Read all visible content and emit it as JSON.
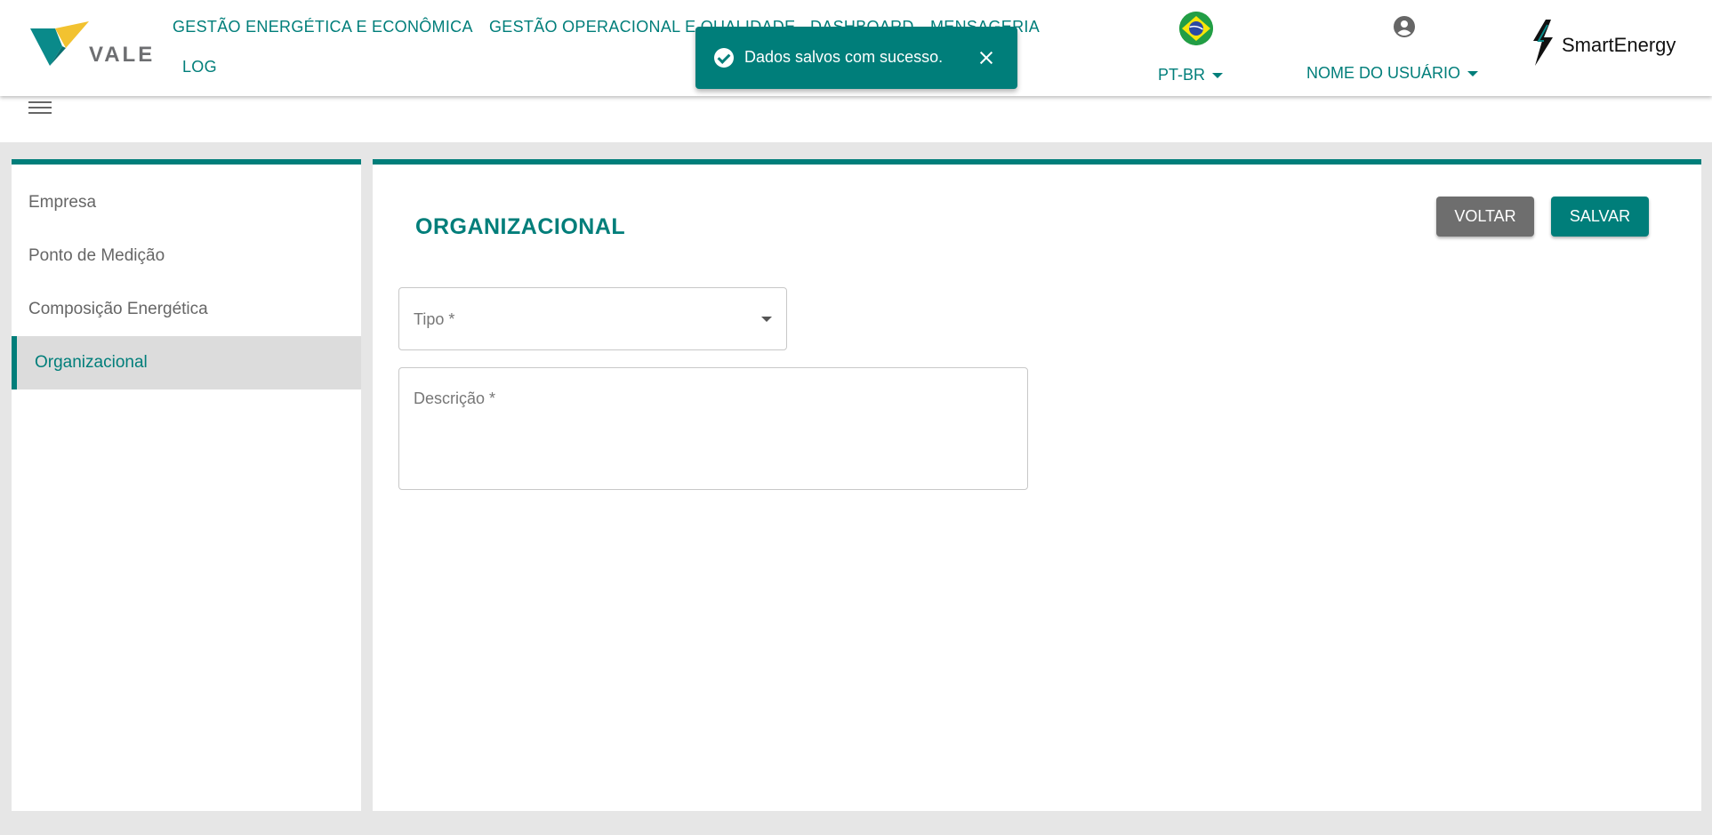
{
  "header": {
    "vale_logo_text": "VALE",
    "nav": [
      "GESTÃO ENERGÉTICA E ECONÔMICA",
      "GESTÃO OPERACIONAL E QUALIDADE",
      "DASHBOARD",
      "MENSAGERIA",
      "LOG"
    ],
    "language": "PT-BR",
    "user_name": "NOME DO USUÁRIO",
    "smart_logo_text": "SmartEnergy"
  },
  "toast": {
    "message": "Dados salvos com sucesso."
  },
  "sidebar": {
    "items": [
      {
        "label": "Empresa",
        "active": false
      },
      {
        "label": "Ponto de Medição",
        "active": false
      },
      {
        "label": "Composição Energética",
        "active": false
      },
      {
        "label": "Organizacional",
        "active": true
      }
    ]
  },
  "main": {
    "title": "ORGANIZACIONAL",
    "back_label": "VOLTAR",
    "save_label": "SALVAR",
    "fields": {
      "tipo_label": "Tipo *",
      "descricao_label": "Descrição *"
    }
  },
  "colors": {
    "accent": "#007e7a",
    "back_button": "#6e6e6e"
  }
}
